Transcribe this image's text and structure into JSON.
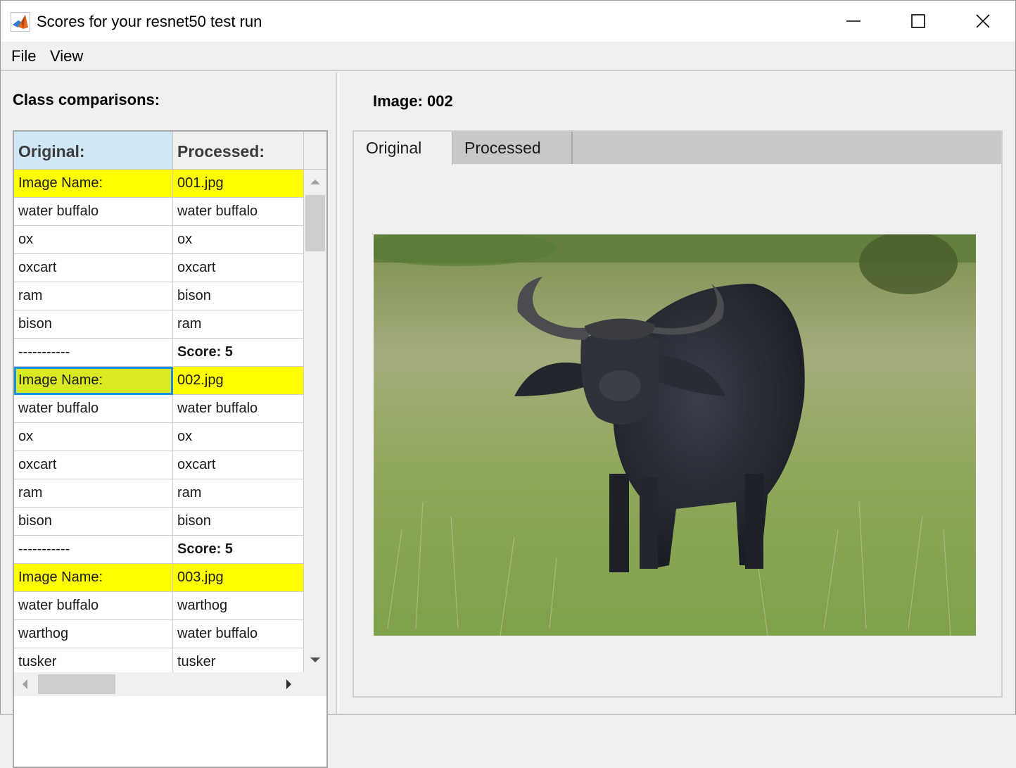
{
  "window": {
    "title": "Scores for your resnet50 test run",
    "minimize_glyph": "—",
    "maximize_glyph": "☐",
    "close_glyph": "✕"
  },
  "menu": {
    "file": "File",
    "view": "View"
  },
  "left": {
    "heading": "Class comparisons:",
    "headers": {
      "original": "Original:",
      "processed": "Processed:"
    },
    "rows": [
      {
        "original": "Image Name:",
        "processed": "001.jpg",
        "highlight": "yellow"
      },
      {
        "original": "water buffalo",
        "processed": "water buffalo"
      },
      {
        "original": "ox",
        "processed": "ox"
      },
      {
        "original": "oxcart",
        "processed": "oxcart"
      },
      {
        "original": "ram",
        "processed": "bison"
      },
      {
        "original": "bison",
        "processed": "ram"
      },
      {
        "original": "-----------",
        "processed": "Score: 5",
        "bold_processed": true
      },
      {
        "original": "Image Name:",
        "processed": "002.jpg",
        "highlight": "yellow",
        "selected": true
      },
      {
        "original": "water buffalo",
        "processed": "water buffalo"
      },
      {
        "original": "ox",
        "processed": "ox"
      },
      {
        "original": "oxcart",
        "processed": "oxcart"
      },
      {
        "original": "ram",
        "processed": "ram"
      },
      {
        "original": "bison",
        "processed": "bison"
      },
      {
        "original": "-----------",
        "processed": "Score: 5",
        "bold_processed": true
      },
      {
        "original": "Image Name:",
        "processed": "003.jpg",
        "highlight": "yellow"
      },
      {
        "original": "water buffalo",
        "processed": "warthog"
      },
      {
        "original": "warthog",
        "processed": "water buffalo"
      },
      {
        "original": "tusker",
        "processed": "tusker"
      }
    ]
  },
  "right": {
    "heading": "Image: 002",
    "tabs": {
      "original": "Original",
      "processed": "Processed"
    },
    "active_tab": "Original"
  },
  "colors": {
    "highlight_yellow": "#ffff00",
    "selected_cell": "#d9ea24",
    "selection_border": "#1a8fe3",
    "header_blue": "#d0e7f5"
  }
}
